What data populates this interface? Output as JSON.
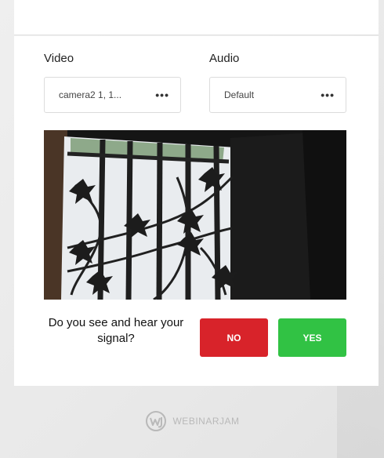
{
  "video": {
    "label": "Video",
    "selected": "camera2 1, 1...",
    "menu_glyph": "•••"
  },
  "audio": {
    "label": "Audio",
    "selected": "Default",
    "menu_glyph": "•••"
  },
  "preview": {
    "icon": "camera-preview"
  },
  "confirm": {
    "question": "Do you see and hear your signal?",
    "no_label": "NO",
    "yes_label": "YES"
  },
  "brand": {
    "name": "WEBINARJAM",
    "logo_icon": "wj-logo-icon"
  },
  "colors": {
    "no": "#d8232a",
    "yes": "#31c244",
    "brand": "#b9b9b9"
  }
}
